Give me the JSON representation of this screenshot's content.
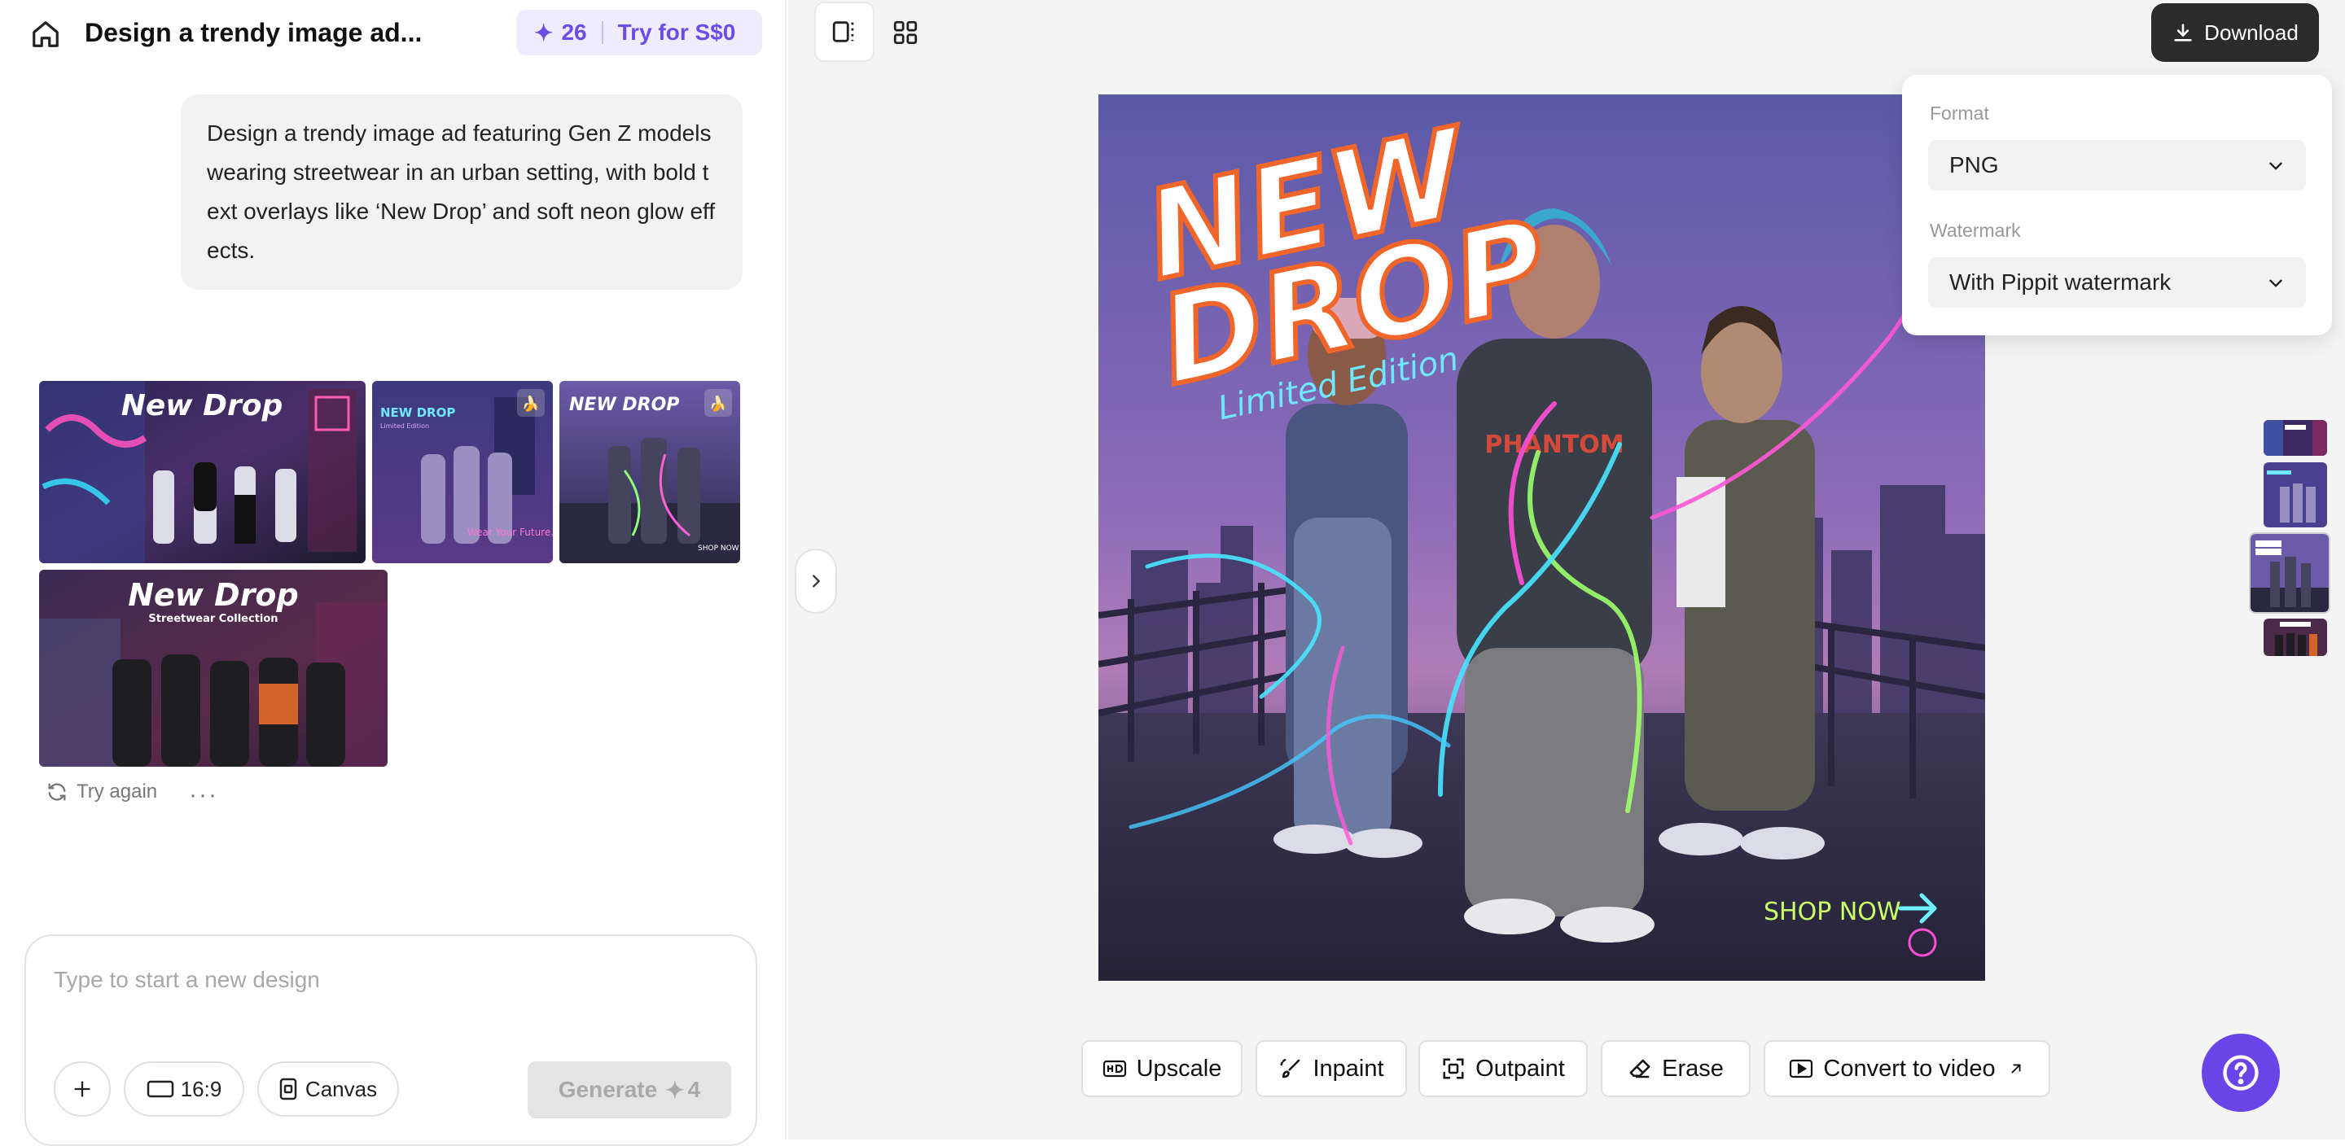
{
  "header": {
    "title": "Design a trendy image ad...",
    "credits": "26",
    "try_label": "Try for S$0"
  },
  "prompt": {
    "text": "Design a trendy image ad featuring Gen Z models wearing streetwear in an urban setting, with bold text overlays like ‘New Drop’ and soft neon glow effects."
  },
  "results": {
    "images": [
      {
        "headline": "New Drop"
      },
      {
        "headline": "NEW DROP",
        "subtitle": "Limited Edition",
        "footer": "Wear Your Future."
      },
      {
        "headline": "NEW DROP",
        "footer": "SHOP NOW"
      },
      {
        "headline": "New Drop",
        "subtitle": "Streetwear Collection"
      }
    ],
    "try_again_label": "Try again",
    "more_label": "···"
  },
  "composer": {
    "placeholder": "Type to start a new design",
    "ratio_label": "16:9",
    "canvas_label": "Canvas",
    "generate_label": "Generate",
    "generate_cost": "4"
  },
  "download": {
    "button_label": "Download",
    "format_label": "Format",
    "format_value": "PNG",
    "watermark_label": "Watermark",
    "watermark_value": "With Pippit watermark"
  },
  "preview": {
    "headline_line1": "NEW",
    "headline_line2": "DROP",
    "subtitle": "Limited Edition",
    "cta": "SHOP NOW",
    "shirt_text": "PHANTOM"
  },
  "tools": {
    "upscale": "Upscale",
    "inpaint": "Inpaint",
    "outpaint": "Outpaint",
    "erase": "Erase",
    "convert": "Convert to video"
  },
  "colors": {
    "accent": "#6a44e6",
    "credits_bg": "#efecff",
    "download_bg": "#2b2b2b"
  }
}
